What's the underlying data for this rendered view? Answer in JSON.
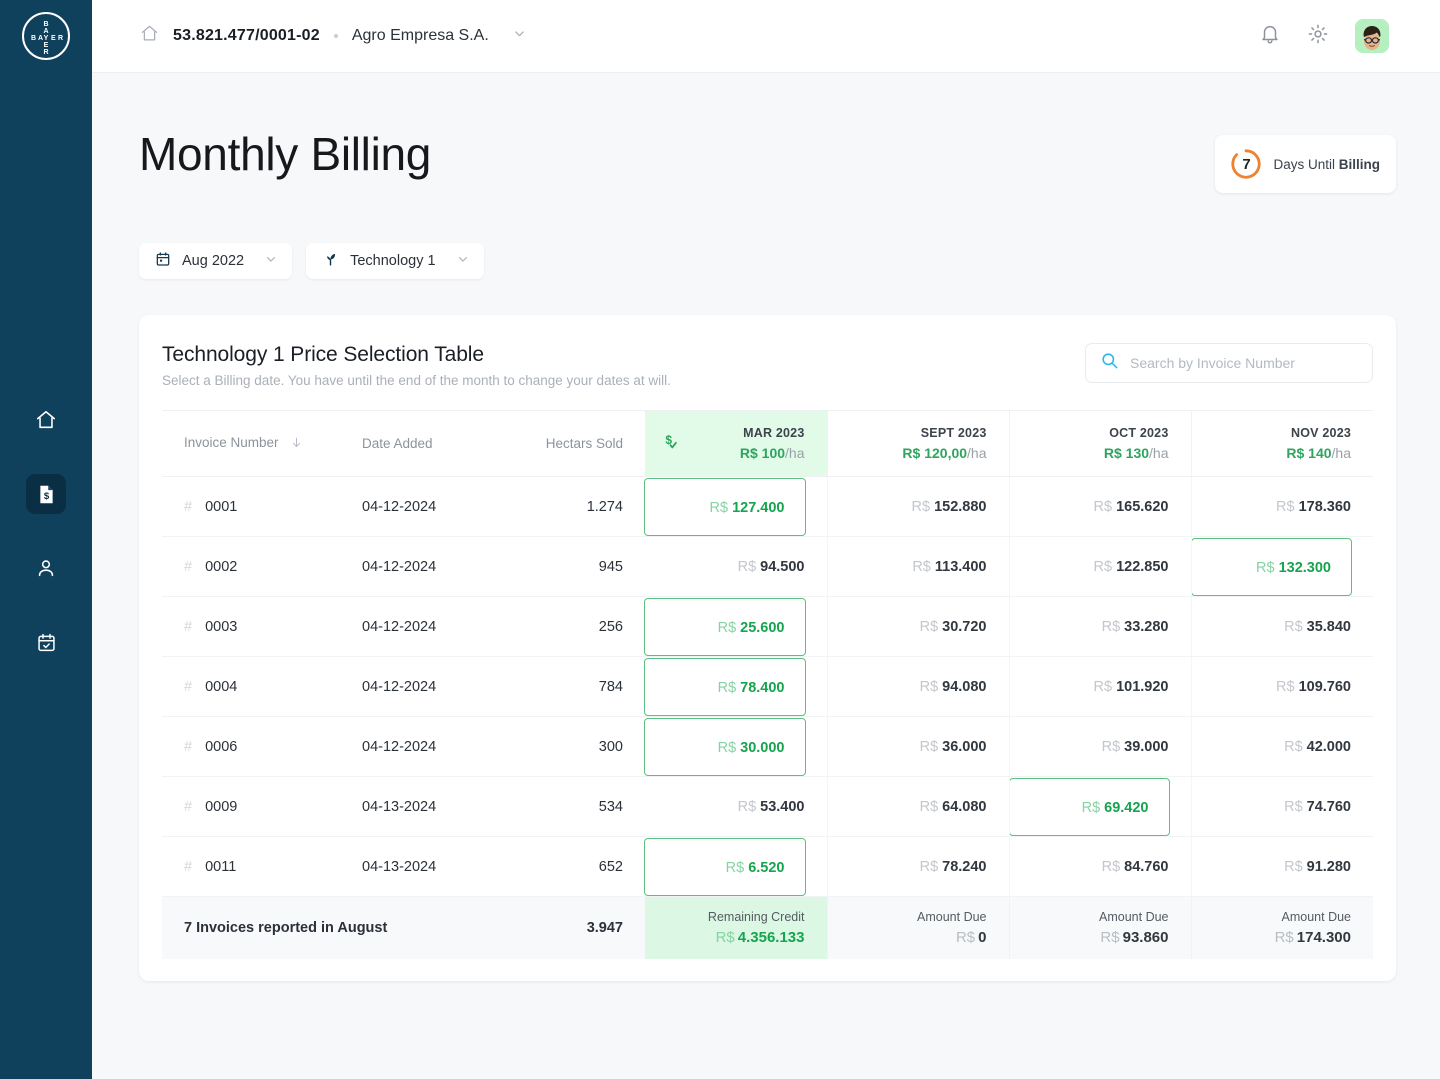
{
  "sidebar": {
    "logo_text": "BAYER",
    "items": [
      {
        "name": "home",
        "icon": "home-icon",
        "active": false
      },
      {
        "name": "billing",
        "icon": "invoice-dollar-icon",
        "active": true
      },
      {
        "name": "account",
        "icon": "user-icon",
        "active": false
      },
      {
        "name": "schedule",
        "icon": "calendar-check-icon",
        "active": false
      }
    ]
  },
  "topbar": {
    "home_icon": "home-icon",
    "cnpj": "53.821.477/0001-02",
    "company": "Agro Empresa S.A.",
    "company_chevron": "chevron-down-icon",
    "bell_icon": "bell-icon",
    "gear_icon": "gear-icon",
    "avatar": "user-avatar"
  },
  "page": {
    "title": "Monthly Billing",
    "countdown": {
      "days": "7",
      "text_prefix": "Days Until ",
      "text_bold": "Billing",
      "ring_color": "#ee8231",
      "progress_pct": 72
    }
  },
  "filters": [
    {
      "icon": "calendar-icon",
      "label": "Aug 2022",
      "chevron": "chevron-down-icon"
    },
    {
      "icon": "sprout-icon",
      "label": "Technology 1",
      "chevron": "chevron-down-icon"
    }
  ],
  "card": {
    "title": "Technology 1 Price Selection Table",
    "subtitle": "Select a Billing date. You have until the end of the month to change your dates at will.",
    "search": {
      "icon": "search-icon",
      "placeholder": "Search by Invoice Number",
      "value": ""
    }
  },
  "table": {
    "columns": {
      "invoice": "Invoice Number",
      "invoice_sort_icon": "sort-arrow-down-icon",
      "date": "Date Added",
      "hectars": "Hectars Sold"
    },
    "months": [
      {
        "label": "MAR 2023",
        "price": "R$ 100",
        "unit": "/ha",
        "selected_column": true,
        "icon": "dollar-check-icon"
      },
      {
        "label": "SEPT 2023",
        "price": "R$ 120,00",
        "unit": "/ha",
        "selected_column": false
      },
      {
        "label": "OCT 2023",
        "price": "R$ 130",
        "unit": "/ha",
        "selected_column": false
      },
      {
        "label": "NOV 2023",
        "price": "R$ 140",
        "unit": "/ha",
        "selected_column": false
      }
    ],
    "currency": "R$",
    "rows": [
      {
        "invoice": "0001",
        "date": "04-12-2024",
        "hectars": "1.274",
        "values": [
          "127.400",
          "152.880",
          "165.620",
          "178.360"
        ],
        "picked": 0
      },
      {
        "invoice": "0002",
        "date": "04-12-2024",
        "hectars": "945",
        "values": [
          "94.500",
          "113.400",
          "122.850",
          "132.300"
        ],
        "picked": 3
      },
      {
        "invoice": "0003",
        "date": "04-12-2024",
        "hectars": "256",
        "values": [
          "25.600",
          "30.720",
          "33.280",
          "35.840"
        ],
        "picked": 0
      },
      {
        "invoice": "0004",
        "date": "04-12-2024",
        "hectars": "784",
        "values": [
          "78.400",
          "94.080",
          "101.920",
          "109.760"
        ],
        "picked": 0
      },
      {
        "invoice": "0006",
        "date": "04-12-2024",
        "hectars": "300",
        "values": [
          "30.000",
          "36.000",
          "39.000",
          "42.000"
        ],
        "picked": 0
      },
      {
        "invoice": "0009",
        "date": "04-13-2024",
        "hectars": "534",
        "values": [
          "53.400",
          "64.080",
          "69.420",
          "74.760"
        ],
        "picked": 2
      },
      {
        "invoice": "0011",
        "date": "04-13-2024",
        "hectars": "652",
        "values": [
          "6.520",
          "78.240",
          "84.760",
          "91.280"
        ],
        "picked": 0
      }
    ],
    "footer": {
      "summary": "7 Invoices reported in August",
      "hectars_total": "3.947",
      "totals": [
        {
          "label": "Remaining Credit",
          "currency": "R$",
          "value": "4.356.133",
          "selected": true
        },
        {
          "label": "Amount Due",
          "currency": "R$",
          "value": "0",
          "selected": false
        },
        {
          "label": "Amount Due",
          "currency": "R$",
          "value": "93.860",
          "selected": false
        },
        {
          "label": "Amount Due",
          "currency": "R$",
          "value": "174.300",
          "selected": false
        }
      ]
    }
  }
}
